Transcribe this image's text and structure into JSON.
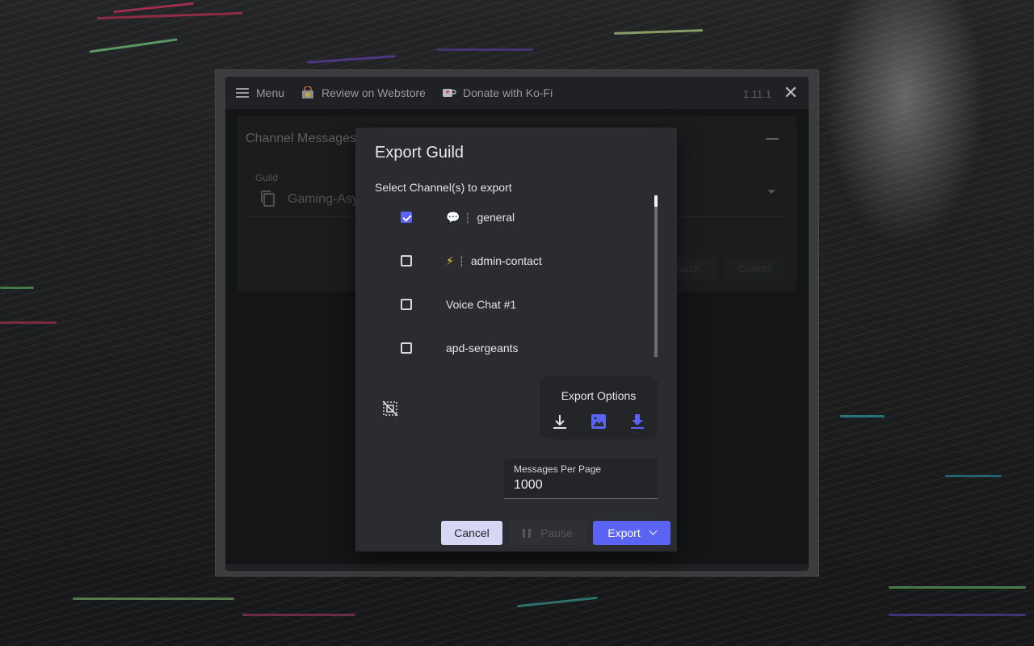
{
  "topbar": {
    "menu_label": "Menu",
    "review_label": "Review on Webstore",
    "donate_label": "Donate with Ko-Fi",
    "version": "1.11.1"
  },
  "channel_card": {
    "title": "Channel Messages",
    "guild_label": "Guild",
    "guild_value": "Gaming-Asy",
    "search_label": "Search",
    "cancel_label": "Cancel"
  },
  "dialog": {
    "title": "Export Guild",
    "select_label": "Select Channel(s) to export",
    "channels": [
      {
        "emoji": "💬",
        "name": "general",
        "checked": true
      },
      {
        "emoji": "⚡",
        "name": "admin-contact",
        "checked": false
      },
      {
        "emoji": "",
        "name": "Voice Chat #1",
        "checked": false
      },
      {
        "emoji": "",
        "name": "apd-sergeants",
        "checked": false
      }
    ],
    "export_options_label": "Export Options",
    "messages_per_page_label": "Messages Per Page",
    "messages_per_page_value": "1000",
    "cancel_label": "Cancel",
    "pause_label": "Pause",
    "export_label": "Export"
  },
  "colors": {
    "accent": "#5b64f2",
    "dialog_bg": "#2b2c2f",
    "cancel_bg": "#d7d6f5"
  }
}
